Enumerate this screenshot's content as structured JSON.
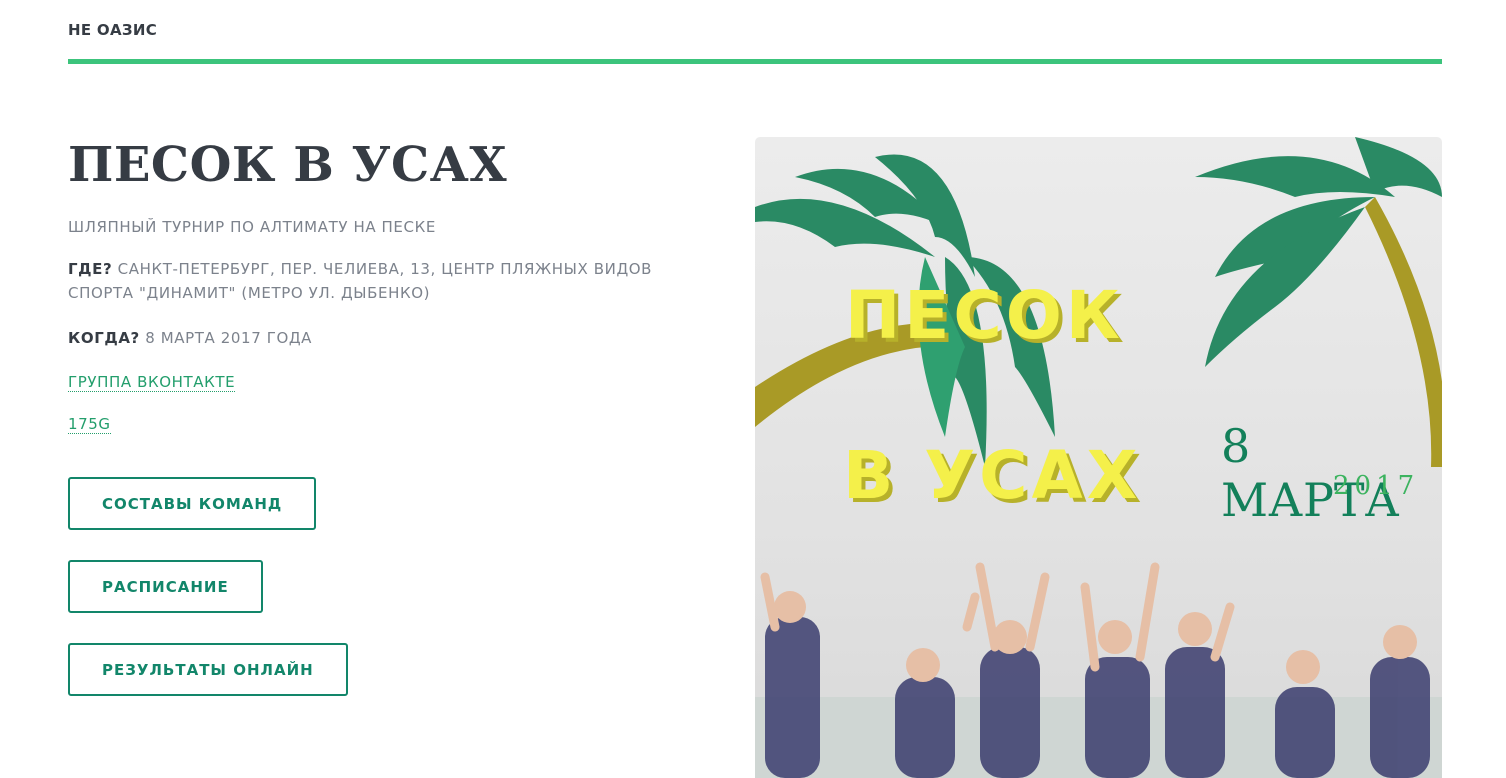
{
  "header": {
    "brand": "НЕ ОАЗИС"
  },
  "event": {
    "title": "ПЕСОК В УСАХ",
    "subtitle": "ШЛЯПНЫЙ ТУРНИР ПО АЛТИМАТУ НА ПЕСКЕ",
    "where_label": "ГДЕ?",
    "where_value": " САНКТ-ПЕТЕРБУРГ, ПЕР. ЧЕЛИЕВА, 13, ЦЕНТР ПЛЯЖНЫХ ВИДОВ СПОРТА \"ДИНАМИТ\" (МЕТРО УЛ. ДЫБЕНКО)",
    "when_label": "КОГДА?",
    "when_value": " 8 МАРТА 2017 ГОДА"
  },
  "links": {
    "vk": "ГРУППА ВКОНТАКТЕ",
    "s175g": "175G"
  },
  "buttons": {
    "teams": "СОСТАВЫ КОМАНД",
    "schedule": "РАСПИСАНИЕ",
    "results": "РЕЗУЛЬТАТЫ ОНЛАЙН"
  },
  "poster": {
    "line1": "ПЕСОК",
    "line2": "В УСАХ",
    "date_day": "8 МАРТА",
    "date_year": "2017"
  },
  "colors": {
    "accent": "#3cc47c",
    "button": "#12866a",
    "link": "#239e6c",
    "text": "#363c44",
    "muted": "#7c828c"
  }
}
